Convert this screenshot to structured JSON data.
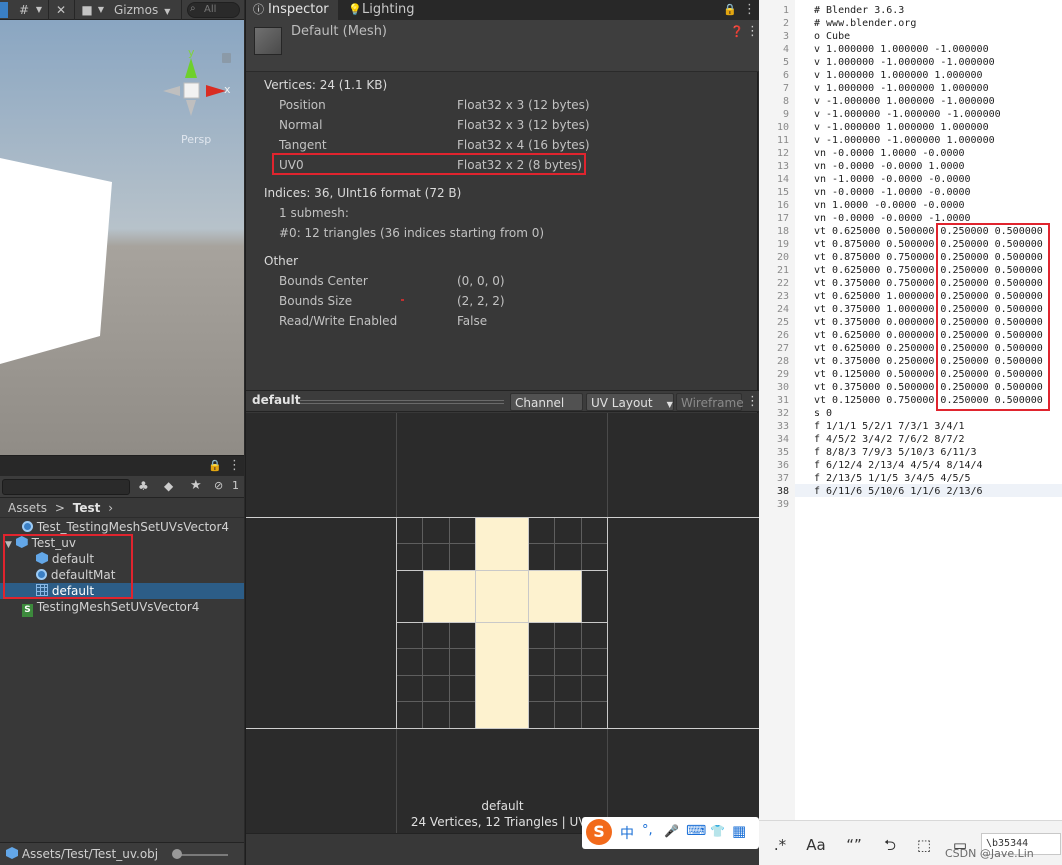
{
  "scene": {
    "toolbar": {
      "gizmos_label": "Gizmos",
      "search_placeholder": "All"
    },
    "axis_y": "y",
    "axis_x": "x",
    "persp_label": "Persp"
  },
  "project": {
    "hidden_count": "1",
    "breadcrumb": {
      "root": "Assets",
      "separator": ">",
      "current": "Test"
    },
    "items": [
      {
        "label": "Test_TestingMeshSetUVsVector4",
        "icon": "material-icon"
      },
      {
        "label": "Test_uv",
        "icon": "prefab-icon"
      },
      {
        "label": "default",
        "icon": "prefab-icon"
      },
      {
        "label": "defaultMat",
        "icon": "material-icon"
      },
      {
        "label": "default",
        "icon": "mesh-icon"
      },
      {
        "label": "TestingMeshSetUVsVector4",
        "icon": "script-icon"
      }
    ],
    "script_glyph": "S",
    "footer_path": "Assets/Test/Test_uv.obj"
  },
  "inspector": {
    "tabs": {
      "inspector": "Inspector",
      "lighting": "Lighting"
    },
    "title": "Default (Mesh)",
    "vertices_header": "Vertices: 24 (1.1 KB)",
    "attributes": [
      {
        "name": "Position",
        "format": "Float32 x 3 (12 bytes)"
      },
      {
        "name": "Normal",
        "format": "Float32 x 3 (12 bytes)"
      },
      {
        "name": "Tangent",
        "format": "Float32 x 4 (16 bytes)"
      },
      {
        "name": "UV0",
        "format": "Float32 x 2 (8 bytes)"
      }
    ],
    "indices_header": "Indices: 36, UInt16 format (72 B)",
    "submesh_count": "1 submesh:",
    "submesh_0": "#0: 12 triangles (36 indices starting from 0)",
    "other_header": "Other",
    "other": [
      {
        "name": "Bounds Center",
        "value": "(0, 0, 0)"
      },
      {
        "name": "Bounds Size",
        "value": "(2, 2, 2)"
      },
      {
        "name": "Read/Write Enabled",
        "value": "False"
      }
    ],
    "preview": {
      "name": "default",
      "channel": "Channel 0",
      "layout": "UV Layout",
      "wireframe": "Wireframe",
      "caption_name": "default",
      "caption_stats": "24 Vertices, 12 Triangles | UV1"
    },
    "ime": {
      "chinese": "中",
      "punct": "°,",
      "mic": "🎤",
      "keyboard": "⌨",
      "shirt": "👕",
      "apps": "▦"
    }
  },
  "editor": {
    "line_numbers": [
      "1",
      "2",
      "3",
      "4",
      "5",
      "6",
      "7",
      "8",
      "9",
      "10",
      "11",
      "12",
      "13",
      "14",
      "15",
      "16",
      "17",
      "18",
      "19",
      "20",
      "21",
      "22",
      "23",
      "24",
      "25",
      "26",
      "27",
      "28",
      "29",
      "30",
      "31",
      "32",
      "33",
      "34",
      "35",
      "36",
      "37",
      "38",
      "39"
    ],
    "lines": [
      "# Blender 3.6.3",
      "# www.blender.org",
      "o Cube",
      "v 1.000000 1.000000 -1.000000",
      "v 1.000000 -1.000000 -1.000000",
      "v 1.000000 1.000000 1.000000",
      "v 1.000000 -1.000000 1.000000",
      "v -1.000000 1.000000 -1.000000",
      "v -1.000000 -1.000000 -1.000000",
      "v -1.000000 1.000000 1.000000",
      "v -1.000000 -1.000000 1.000000",
      "vn -0.0000 1.0000 -0.0000",
      "vn -0.0000 -0.0000 1.0000",
      "vn -1.0000 -0.0000 -0.0000",
      "vn -0.0000 -1.0000 -0.0000",
      "vn 1.0000 -0.0000 -0.0000",
      "vn -0.0000 -0.0000 -1.0000",
      "vt 0.625000 0.500000 0.250000 0.500000",
      "vt 0.875000 0.500000 0.250000 0.500000",
      "vt 0.875000 0.750000 0.250000 0.500000",
      "vt 0.625000 0.750000 0.250000 0.500000",
      "vt 0.375000 0.750000 0.250000 0.500000",
      "vt 0.625000 1.000000 0.250000 0.500000",
      "vt 0.375000 1.000000 0.250000 0.500000",
      "vt 0.375000 0.000000 0.250000 0.500000",
      "vt 0.625000 0.000000 0.250000 0.500000",
      "vt 0.625000 0.250000 0.250000 0.500000",
      "vt 0.375000 0.250000 0.250000 0.500000",
      "vt 0.125000 0.500000 0.250000 0.500000",
      "vt 0.375000 0.500000 0.250000 0.500000",
      "vt 0.125000 0.750000 0.250000 0.500000",
      "s 0",
      "f 1/1/1 5/2/1 7/3/1 3/4/1",
      "f 4/5/2 3/4/2 7/6/2 8/7/2",
      "f 8/8/3 7/9/3 5/10/3 6/11/3",
      "f 6/12/4 2/13/4 4/5/4 8/14/4",
      "f 2/13/5 1/1/5 3/4/5 4/5/5",
      "f 6/11/6 5/10/6 1/1/6 2/13/6",
      ""
    ],
    "toolbar": {
      "regex": ".*",
      "match_case": "Aa",
      "quotes": "“”",
      "wrap": "⮌",
      "selection": "⬚",
      "monitor": "▭",
      "status": "\\b35344"
    },
    "watermark": "CSDN @Jave.Lin"
  }
}
